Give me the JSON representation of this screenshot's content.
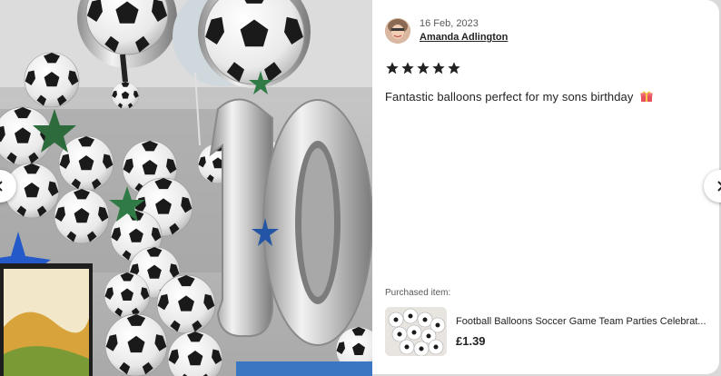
{
  "review": {
    "date": "16 Feb, 2023",
    "reviewer": "Amanda Adlington",
    "rating": 5,
    "text": "Fantastic balloons perfect for my sons birthday"
  },
  "purchased": {
    "label": "Purchased item:",
    "title": "Football Balloons Soccer Game Team Parties Celebrat...",
    "price": "£1.39"
  },
  "icons": {
    "prev": "chevron-left-icon",
    "next": "chevron-right-icon",
    "gift": "gift-emoji-icon",
    "star": "star-icon"
  },
  "colors": {
    "star": "#222222",
    "text": "#222222",
    "muted": "#595959"
  }
}
